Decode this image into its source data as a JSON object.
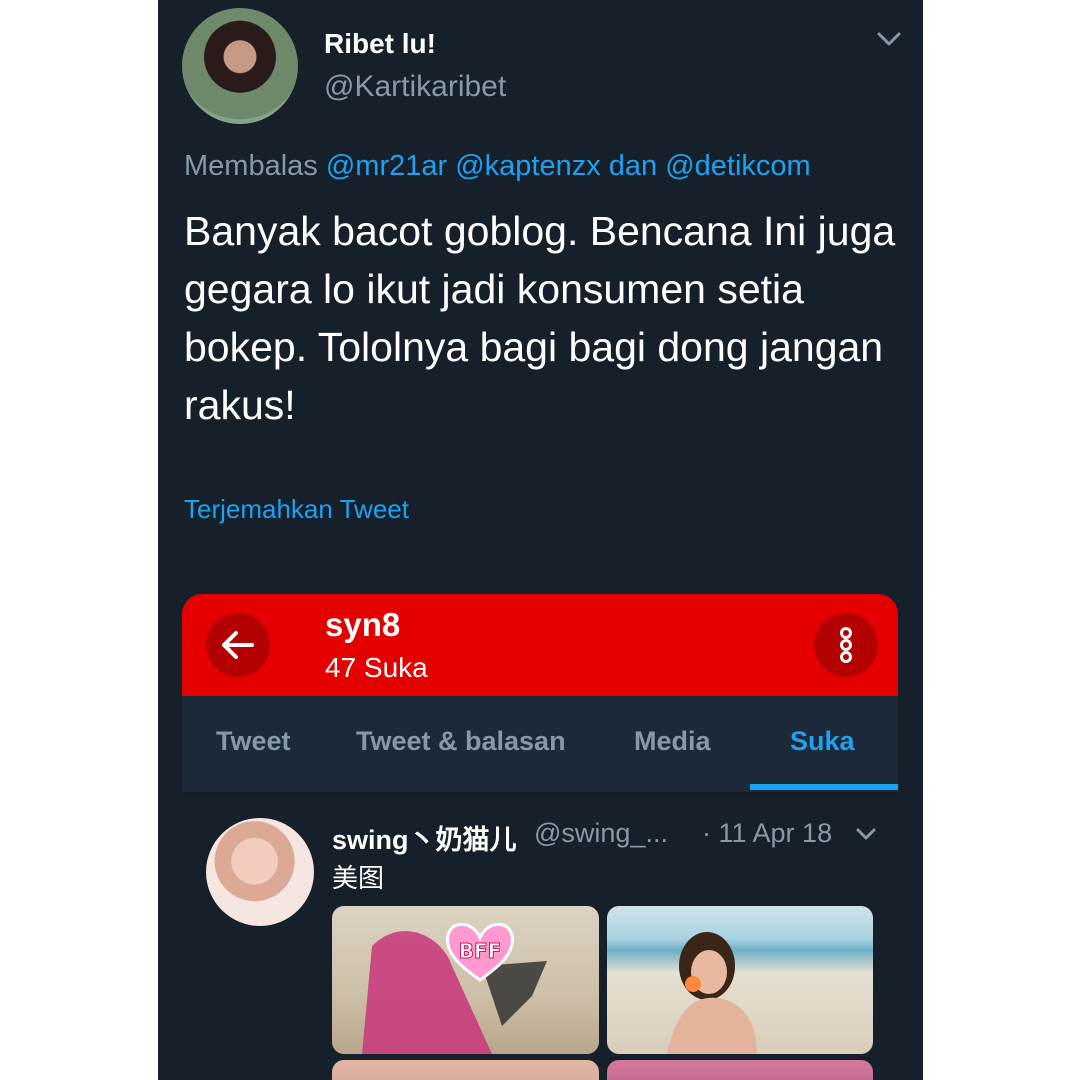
{
  "tweet": {
    "author_name": "Ribet lu!",
    "author_handle": "@Kartikaribet",
    "reply_prefix": "Membalas",
    "reply_mention_1": "@mr21ar",
    "reply_mention_2": "@kaptenzx",
    "reply_joiner": "dan",
    "reply_mention_3": "@detikcom",
    "text": "Banyak bacot goblog. Bencana Ini juga gegara lo ikut jadi konsumen setia bokep. Tololnya bagi bagi dong jangan rakus!",
    "translate_label": "Terjemahkan Tweet"
  },
  "embedded_profile": {
    "name": "syn8",
    "likes_count": "47 Suka",
    "tabs": [
      "Tweet",
      "Tweet & balasan",
      "Media",
      "Suka"
    ],
    "active_tab": "Suka",
    "liked_tweet": {
      "author_name": "swing丶奶猫儿",
      "author_handle": "@swing_...",
      "date": "· 11 Apr 18",
      "text": "美图",
      "image_badge": "BFF"
    }
  },
  "colors": {
    "background": "#15202b",
    "accent": "#1da1f2",
    "profile_header": "#e50000",
    "muted_text": "#8899a6"
  }
}
